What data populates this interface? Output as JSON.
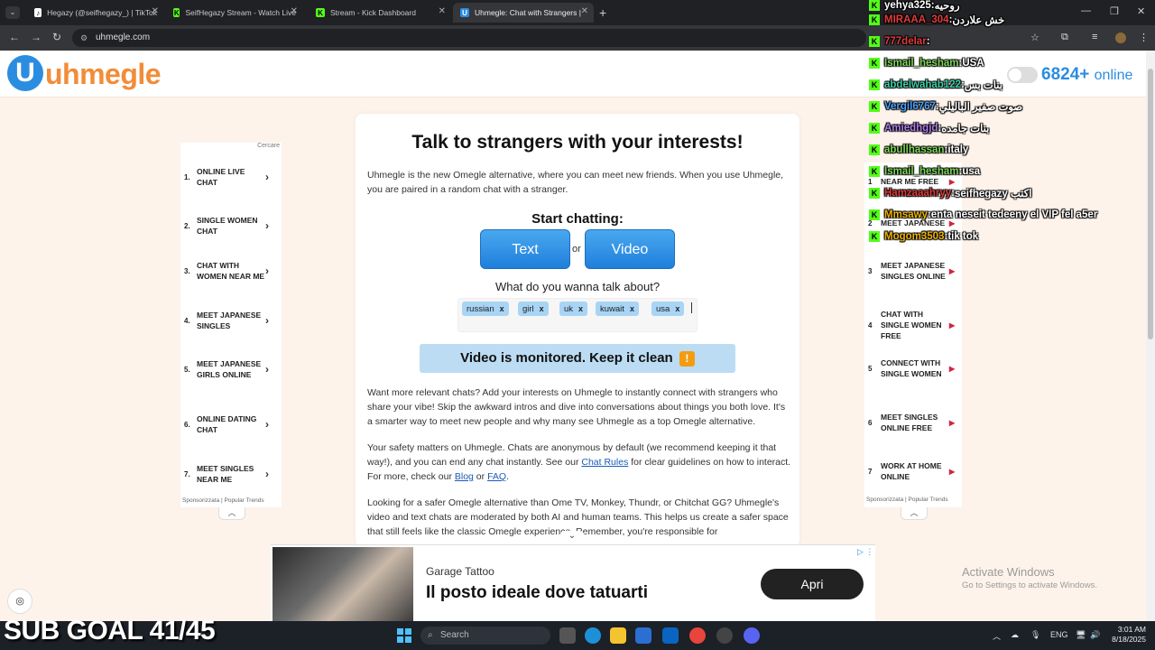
{
  "browser": {
    "tabs": [
      {
        "title": "Hegazy (@seifhegazy_) | TikTok",
        "icon": "tiktok-icon"
      },
      {
        "title": "SeifHegazy Stream - Watch Live",
        "icon": "kick-icon"
      },
      {
        "title": "Stream - Kick Dashboard",
        "icon": "kick-icon"
      },
      {
        "title": "Uhmegle: Chat with Strangers |",
        "icon": "uhmegle-icon"
      }
    ],
    "url": "uhmegle.com"
  },
  "site": {
    "logo_text": "uhmegle",
    "online_count": "6824+",
    "online_label": "online"
  },
  "left_ad": {
    "cercare": "Cercare",
    "items": [
      {
        "num": "1.",
        "label": "ONLINE LIVE CHAT"
      },
      {
        "num": "2.",
        "label": "SINGLE WOMEN CHAT"
      },
      {
        "num": "3.",
        "label": "CHAT WITH WOMEN NEAR ME"
      },
      {
        "num": "4.",
        "label": "MEET JAPANESE SINGLES"
      },
      {
        "num": "5.",
        "label": "MEET JAPANESE GIRLS ONLINE"
      },
      {
        "num": "6.",
        "label": "ONLINE DATING CHAT"
      },
      {
        "num": "7.",
        "label": "MEET SINGLES NEAR ME"
      }
    ],
    "footer": "Sponsorizzata | Popular Trends"
  },
  "right_ad": {
    "items": [
      {
        "num": "1",
        "label": "NEAR ME FREE"
      },
      {
        "num": "2",
        "label": "MEET JAPANESE"
      },
      {
        "num": "3",
        "label": "MEET JAPANESE SINGLES ONLINE"
      },
      {
        "num": "4",
        "label": "CHAT WITH SINGLE WOMEN FREE"
      },
      {
        "num": "5",
        "label": "CONNECT WITH SINGLE WOMEN"
      },
      {
        "num": "6",
        "label": "MEET SINGLES ONLINE FREE"
      },
      {
        "num": "7",
        "label": "WORK AT HOME ONLINE"
      }
    ],
    "footer": "Sponsorizzata | Popular Trends"
  },
  "main": {
    "title": "Talk to strangers with your interests!",
    "intro": "Uhmegle is the new Omegle alternative, where you can meet new friends. When you use Uhmegle, you are paired in a random chat with a stranger.",
    "start_label": "Start chatting:",
    "text_button": "Text",
    "or_label": "or",
    "video_button": "Video",
    "interests_prompt": "What do you wanna talk about?",
    "tags": [
      "russian",
      "girl",
      "uk",
      "kuwait",
      "usa"
    ],
    "tag_remove": "x",
    "monitor_notice": "Video is monitored. Keep it clean",
    "warn_glyph": "!",
    "para1": "Want more relevant chats? Add your interests on Uhmegle to instantly connect with strangers who share your vibe! Skip the awkward intros and dive into conversations about things you both love. It's a smarter way to meet new people and why many see Uhmegle as a top Omegle alternative.",
    "para2_a": "Your safety matters on Uhmegle. Chats are anonymous by default (we recommend keeping it that way!), and you can end any chat instantly. See our ",
    "para2_link1": "Chat Rules",
    "para2_b": " for clear guidelines on how to interact. For more, check our ",
    "para2_link2": "Blog",
    "para2_c": " or ",
    "para2_link3": "FAQ",
    "para2_d": ".",
    "para3": "Looking for a safer Omegle alternative than Ome TV, Monkey, Thundr, or Chitchat GG? Uhmegle's video and text chats are moderated by both AI and human teams. This helps us create a safer space that still feels like the classic Omegle experience. Remember, you're responsible for"
  },
  "chat_overlay": [
    {
      "user": "yehya325",
      "msg": "روحيه",
      "color": "#ffffff"
    },
    {
      "user": "MIRAAA_304",
      "msg": "خش علاردن",
      "color": "#e23b3b"
    },
    {
      "user": "777delar",
      "msg": "",
      "color": "#e23b3b"
    },
    {
      "user": "Ismail_hesham",
      "msg": "USA",
      "color": "#7ed957"
    },
    {
      "user": "abdelwahab122",
      "msg": "بنات بس",
      "color": "#3ad1a6"
    },
    {
      "user": "Vergil6767",
      "msg": "صوت صفير الباليلي",
      "color": "#4aa3ff"
    },
    {
      "user": "Amiedhgjd",
      "msg": "بنات جامده",
      "color": "#b07cf0"
    },
    {
      "user": "abullhassan",
      "msg": "italy",
      "color": "#7ed957"
    },
    {
      "user": "Ismail_hesham",
      "msg": "usa",
      "color": "#7ed957"
    },
    {
      "user": "Hamzaaahryy",
      "msg": "seifhegazy اكتب",
      "color": "#e23b3b"
    },
    {
      "user": "Mmsawy",
      "msg": "enta neseit tedeeny el VIP fel a5er",
      "color": "#f0b400"
    },
    {
      "user": "Mogom3503",
      "msg": "tik tok",
      "color": "#f0b400"
    }
  ],
  "bottom_ad": {
    "brand": "Garage Tattoo",
    "headline": "Il posto ideale dove tatuarti",
    "cta": "Apri"
  },
  "watermark": {
    "line1": "Activate Windows",
    "line2": "Go to Settings to activate Windows."
  },
  "stream": {
    "sub_goal": "SUB GOAL 41/45"
  },
  "taskbar": {
    "search_placeholder": "Search",
    "lang": "ENG",
    "time": "3:01 AM",
    "date": "8/18/2025"
  }
}
